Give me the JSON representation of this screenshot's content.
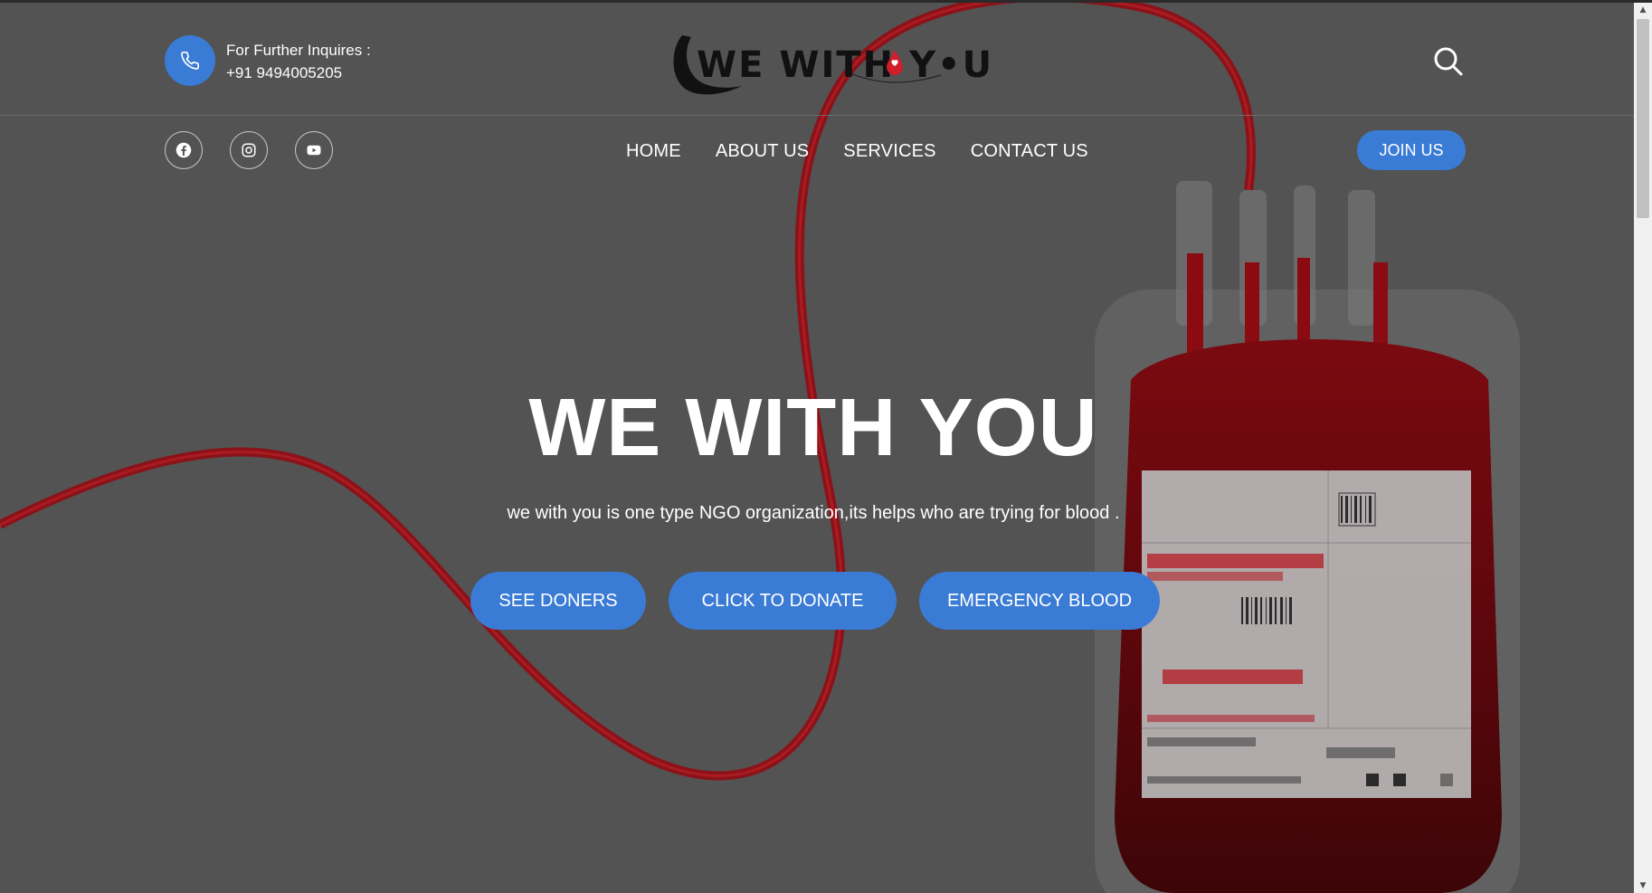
{
  "header": {
    "phone_label": "For Further Inquires :",
    "phone_number": "+91 9494005205",
    "logo_text": "WE WITH Y•U",
    "logo_alt": "WE WITH YOU"
  },
  "social": [
    {
      "name": "facebook-icon"
    },
    {
      "name": "instagram-icon"
    },
    {
      "name": "youtube-icon"
    }
  ],
  "nav": {
    "items": [
      {
        "label": "HOME"
      },
      {
        "label": "ABOUT US"
      },
      {
        "label": "SERVICES"
      },
      {
        "label": "CONTACT US"
      }
    ],
    "join_label": "JOIN US"
  },
  "hero": {
    "title": "WE WITH YOU",
    "subtitle": "we with you is one type NGO organization,its helps who are trying for blood .",
    "buttons": [
      {
        "label": "SEE DONERS"
      },
      {
        "label": "CLICK TO DONATE"
      },
      {
        "label": "EMERGENCY BLOOD"
      }
    ]
  },
  "colors": {
    "accent": "#3a7bd5",
    "overlay": "#535353",
    "blood": "#a3141b"
  }
}
